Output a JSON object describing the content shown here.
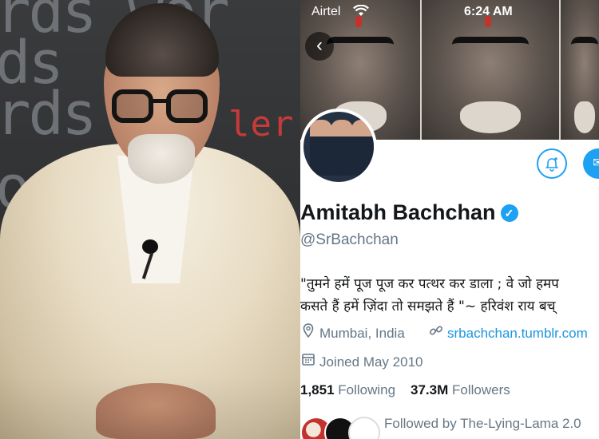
{
  "photo": {
    "background_words": [
      "rds wor",
      "ds",
      "rds",
      "onv"
    ],
    "red_word": "ler"
  },
  "status_bar": {
    "carrier": "Airtel",
    "time": "6:24 AM"
  },
  "profile": {
    "name": "Amitabh Bachchan",
    "handle": "@SrBachchan",
    "verified": true,
    "bio_line1": "\"तुमने हमें पूज पूज कर पत्थर कर डाला ; वे जो हमप",
    "bio_line2": "कसते हैं हमें ज़िंदा तो समझते हैं \"~ हरिवंश राय बच्",
    "location": "Mumbai, India",
    "website": "srbachchan.tumblr.com",
    "joined": "Joined May 2010",
    "following_count": "1,851",
    "following_label": "Following",
    "followers_count": "37.3M",
    "followers_label": "Followers",
    "followed_by": "Followed by The-Lying-Lama 2.0"
  },
  "icons": {
    "back": "chevron-left-icon",
    "notify": "bell-plus-icon",
    "message": "envelope-icon",
    "location": "location-pin-icon",
    "link": "link-icon",
    "calendar": "calendar-icon"
  },
  "colors": {
    "accent": "#1da1f2",
    "link": "#1b95e0",
    "secondary_text": "#657786",
    "primary_text": "#14171a"
  }
}
